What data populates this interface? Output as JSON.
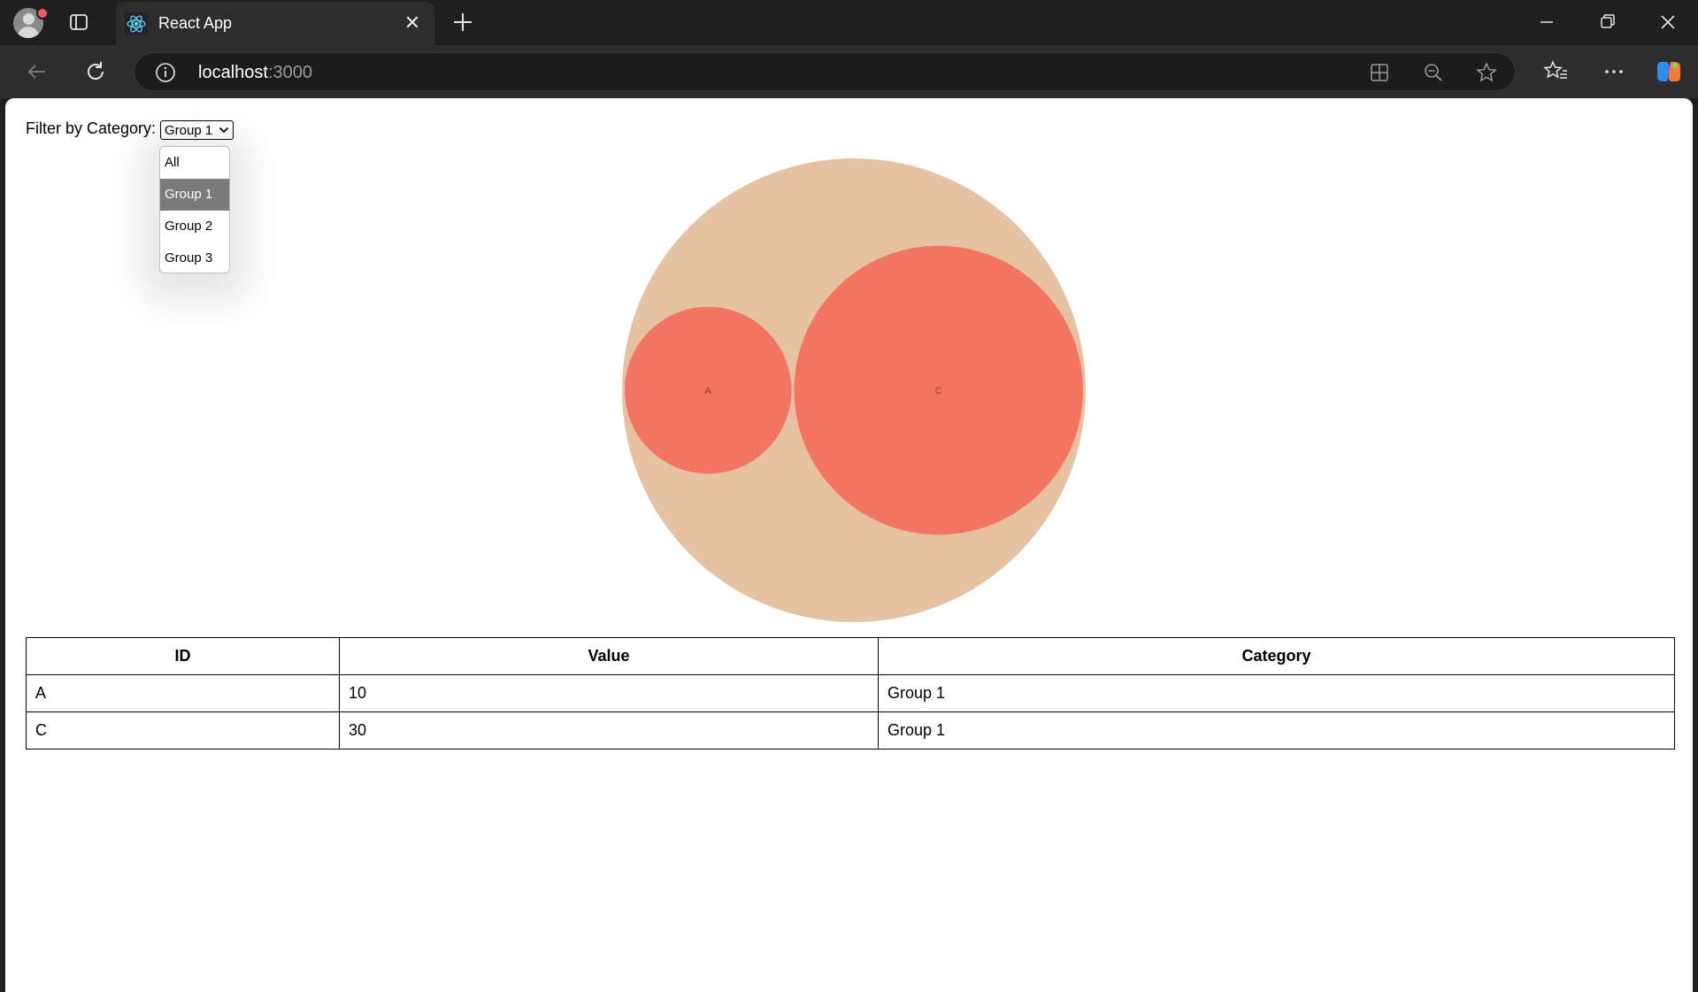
{
  "browser": {
    "tab_title": "React App",
    "url_host": "localhost",
    "url_port": ":3000"
  },
  "filter": {
    "label": "Filter by Category:",
    "selected": "Group 1",
    "options": [
      "All",
      "Group 1",
      "Group 2",
      "Group 3"
    ]
  },
  "chart_data": {
    "type": "bubble-pack",
    "nodes": [
      {
        "id": "A",
        "value": 10,
        "category": "Group 1"
      },
      {
        "id": "C",
        "value": 30,
        "category": "Group 1"
      }
    ],
    "colors": {
      "parent": "#e6c2a3",
      "leaf": "#f27562",
      "label": "#8a3a2e"
    }
  },
  "table": {
    "headers": [
      "ID",
      "Value",
      "Category"
    ],
    "rows": [
      {
        "id": "A",
        "value": "10",
        "category": "Group 1"
      },
      {
        "id": "C",
        "value": "30",
        "category": "Group 1"
      }
    ]
  }
}
